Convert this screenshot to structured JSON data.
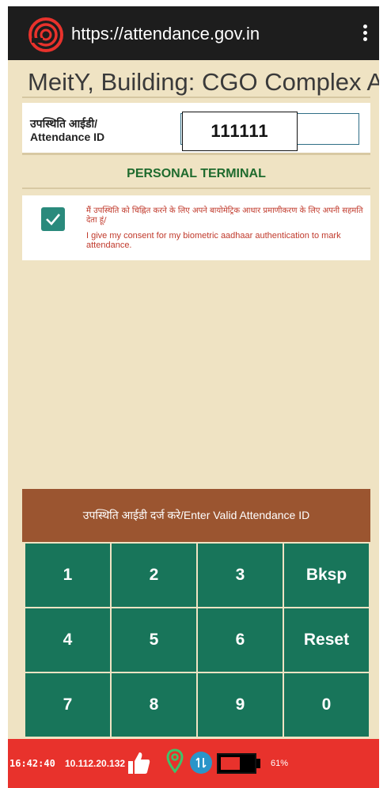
{
  "browser": {
    "url": "https://attendance.gov.in",
    "menu_icon": "more-vert-icon"
  },
  "header": {
    "title": "MeitY, Building: CGO Complex A"
  },
  "attendance": {
    "label_hi": "उपस्थिति आईडी/",
    "label_en": "Attendance ID",
    "value": "111111"
  },
  "terminal": {
    "label": "PERSONAL TERMINAL"
  },
  "consent": {
    "checked": true,
    "text_hi": "मैं उपस्थिति को चिह्नित करने के लिए अपने बायोमेट्रिक आधार प्रमाणीकरण के लिए अपनी सहमति देता हूं/",
    "text_en": "I give my consent for my biometric aadhaar authentication to mark attendance."
  },
  "prompt": {
    "text": "उपस्थिति आईडी दर्ज करे/Enter Valid Attendance ID"
  },
  "keypad": {
    "keys": [
      "1",
      "2",
      "3",
      "Bksp",
      "4",
      "5",
      "6",
      "Reset",
      "7",
      "8",
      "9",
      "0"
    ]
  },
  "status": {
    "time": "16:42:40",
    "ip": "10.112.20.132",
    "battery_pct": "61%",
    "battery_level": 0.61,
    "icons": [
      "thumbs-up-icon",
      "location-pin-icon",
      "sync-icon",
      "battery-icon"
    ],
    "colors": {
      "bar": "#e8322c",
      "key": "#18755a",
      "prompt": "#9b5530"
    }
  }
}
